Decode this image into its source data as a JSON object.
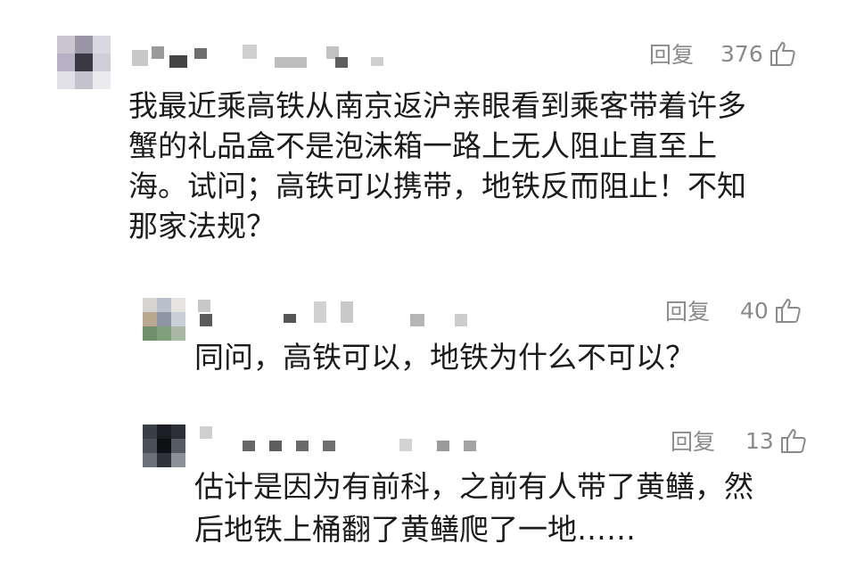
{
  "comments": [
    {
      "reply_label": "回复",
      "likes": "376",
      "text_lines": [
        "我最近乘高铁从南京返沪亲眼看到乘客带着许多",
        "蟹的礼品盒不是泡沫箱一路上无人阻止直至上",
        "海。试问；高铁可以携带，地铁反而阻止！不知",
        "那家法规？"
      ]
    },
    {
      "reply_label": "回复",
      "likes": "40",
      "text_lines": [
        "同问，高铁可以，地铁为什么不可以？"
      ]
    },
    {
      "reply_label": "回复",
      "likes": "13",
      "text_lines": [
        "估计是因为有前科，之前有人带了黄鳝，然",
        "后地铁上桶翻了黄鳝爬了一地……"
      ]
    }
  ],
  "colors": {
    "action_gray": "#8a8a8a",
    "text": "#1b1b1b",
    "background": "#ffffff"
  },
  "icons": {
    "like": "thumbs-up-outline-icon"
  }
}
